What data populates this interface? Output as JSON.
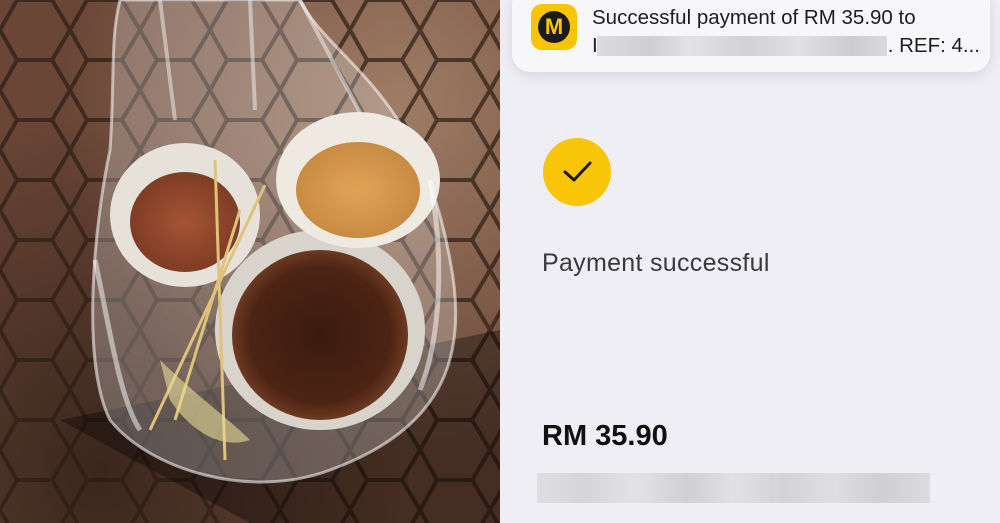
{
  "photo": {
    "scene": "plastic bag with takeaway containers"
  },
  "notification": {
    "app_icon": "m-logo-icon",
    "message_line1": "Successful payment of RM 35.90 to",
    "message_line2_start": "I",
    "message_line2_end": ". REF: 4..."
  },
  "payment": {
    "check_icon": "checkmark-icon",
    "status": "Payment successful",
    "amount": "RM 35.90"
  },
  "colors": {
    "accent": "#f8c508",
    "screen_bg": "#efeef4"
  }
}
